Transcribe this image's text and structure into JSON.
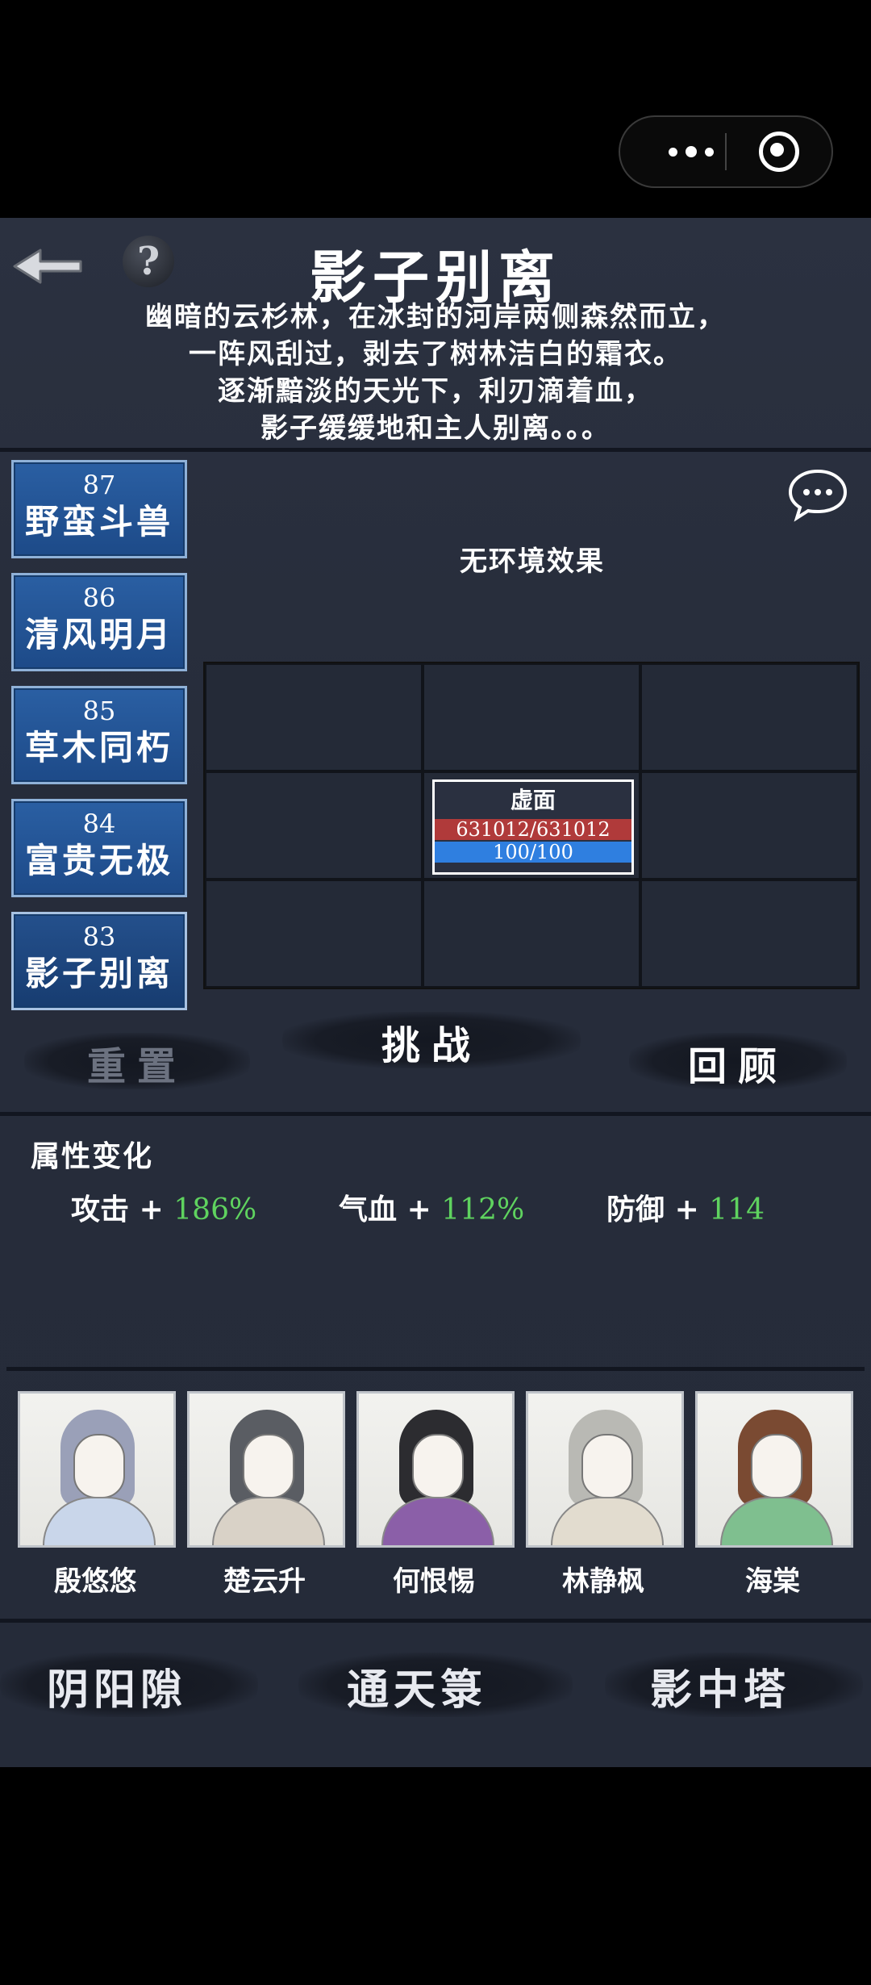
{
  "capsule": {
    "menu_icon": "more-dots-icon",
    "close_icon": "target-circle-icon"
  },
  "header": {
    "back_icon": "back-arrow-icon",
    "help_icon": "question-mark-icon",
    "help_label": "?",
    "title": "影子别离",
    "story": [
      "幽暗的云杉林，在冰封的河岸两侧森然而立，",
      "一阵风刮过，剥去了树林洁白的霜衣。",
      "逐渐黯淡的天光下，利刃滴着血，",
      "影子缓缓地和主人别离。。。"
    ]
  },
  "levels": [
    {
      "num": "87",
      "name": "野蛮斗兽"
    },
    {
      "num": "86",
      "name": "清风明月"
    },
    {
      "num": "85",
      "name": "草木同朽"
    },
    {
      "num": "84",
      "name": "富贵无极"
    },
    {
      "num": "83",
      "name": "影子别离"
    }
  ],
  "environment": {
    "chat_icon": "chat-bubble-icon",
    "effect_text": "无环境效果"
  },
  "enemy": {
    "name": "虚面",
    "hp": "631012/631012",
    "mp": "100/100"
  },
  "actions": {
    "reset": "重置",
    "challenge": "挑战",
    "review": "回顾"
  },
  "attributes": {
    "title": "属性变化",
    "items": [
      {
        "label": "攻击",
        "sign": "+",
        "value": "186%"
      },
      {
        "label": "气血",
        "sign": "+",
        "value": "112%"
      },
      {
        "label": "防御",
        "sign": "+",
        "value": "114"
      }
    ]
  },
  "party": [
    {
      "name": "殷悠悠"
    },
    {
      "name": "楚云升"
    },
    {
      "name": "何恨惕"
    },
    {
      "name": "林静枫"
    },
    {
      "name": "海棠"
    }
  ],
  "bottom_nav": [
    "阴阳隙",
    "通天箓",
    "影中塔"
  ],
  "colors": {
    "level_button": "#2a5fa3",
    "hp": "#b03a3a",
    "mp": "#2f7fe0",
    "bonus": "#5fd35f"
  }
}
